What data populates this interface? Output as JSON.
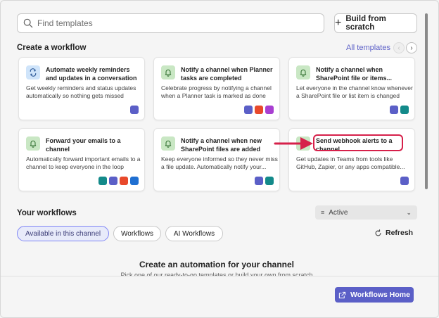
{
  "search": {
    "placeholder": "Find templates",
    "icon": "search-icon"
  },
  "build_button": {
    "label": "Build from scratch",
    "icon": "plus-icon"
  },
  "create_section": {
    "title": "Create a workflow",
    "all_templates": "All templates",
    "cards": [
      {
        "title": "Automate weekly reminders and updates in a conversation",
        "description": "Get weekly reminders and status updates automatically so nothing gets missed",
        "icon": "repeat-icon",
        "apps": [
          "teams"
        ]
      },
      {
        "title": "Notify a channel when Planner tasks are completed",
        "description": "Celebrate progress by notifying a channel when a Planner task is marked as done",
        "icon": "bell-icon",
        "apps": [
          "teams",
          "office",
          "planner"
        ]
      },
      {
        "title": "Notify a channel when SharePoint file or items...",
        "description": "Let everyone in the channel know whenever a SharePoint file or list item is changed",
        "icon": "bell-icon",
        "apps": [
          "teams",
          "sharepoint"
        ]
      },
      {
        "title": "Forward your emails to a channel",
        "description": "Automatically forward important emails to a channel to keep everyone in the loop",
        "icon": "bell-icon",
        "apps": [
          "sharepoint",
          "teams",
          "office",
          "outlook"
        ]
      },
      {
        "title": "Notify a channel when new SharePoint files are added",
        "description": "Keep everyone informed so they never miss a file update. Automatically notify your...",
        "icon": "bell-icon",
        "apps": [
          "teams",
          "sharepoint"
        ]
      },
      {
        "title": "Send webhook alerts to a channel",
        "description": "Get updates in Teams from tools like GitHub, Zapier, or any apps compatible...",
        "icon": "bell-icon",
        "apps": [
          "teams"
        ]
      }
    ]
  },
  "your_workflows": {
    "title": "Your workflows",
    "filter": "Active",
    "tabs": [
      "Available in this channel",
      "Workflows",
      "AI Workflows"
    ],
    "refresh": "Refresh",
    "empty_title": "Create an automation for your channel",
    "empty_sub": "Pick one of our ready-to-go templates or build your own from scratch"
  },
  "footer": {
    "home_button": "Workflows Home"
  },
  "colors": {
    "accent": "#5b5fc7",
    "highlight": "#d6204a"
  }
}
